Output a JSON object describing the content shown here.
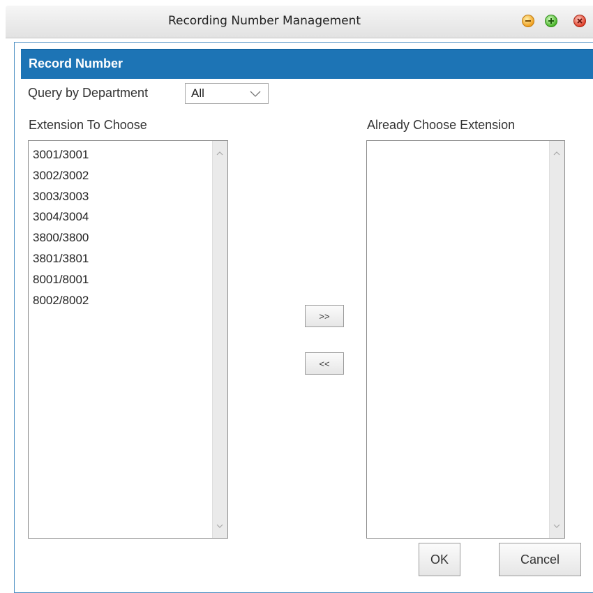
{
  "window": {
    "title": "Recording Number Management",
    "controls": [
      {
        "icon": "minimize-icon",
        "color": "#f0a020"
      },
      {
        "icon": "maximize-icon",
        "color": "#4cb52c"
      },
      {
        "icon": "close-icon",
        "color": "#e0402a"
      }
    ]
  },
  "section": {
    "title": "Record Number",
    "accent_color": "#1d74b5"
  },
  "filter": {
    "label": "Query by Department",
    "selected": "All"
  },
  "available": {
    "label": "Extension To Choose",
    "items": [
      "3001/3001",
      "3002/3002",
      "3003/3003",
      "3004/3004",
      "3800/3800",
      "3801/3801",
      "8001/8001",
      "8002/8002"
    ]
  },
  "chosen": {
    "label": "Already Choose Extension",
    "items": []
  },
  "actions": {
    "add_label": ">>",
    "remove_label": "<<",
    "ok_label": "OK",
    "cancel_label": "Cancel"
  }
}
